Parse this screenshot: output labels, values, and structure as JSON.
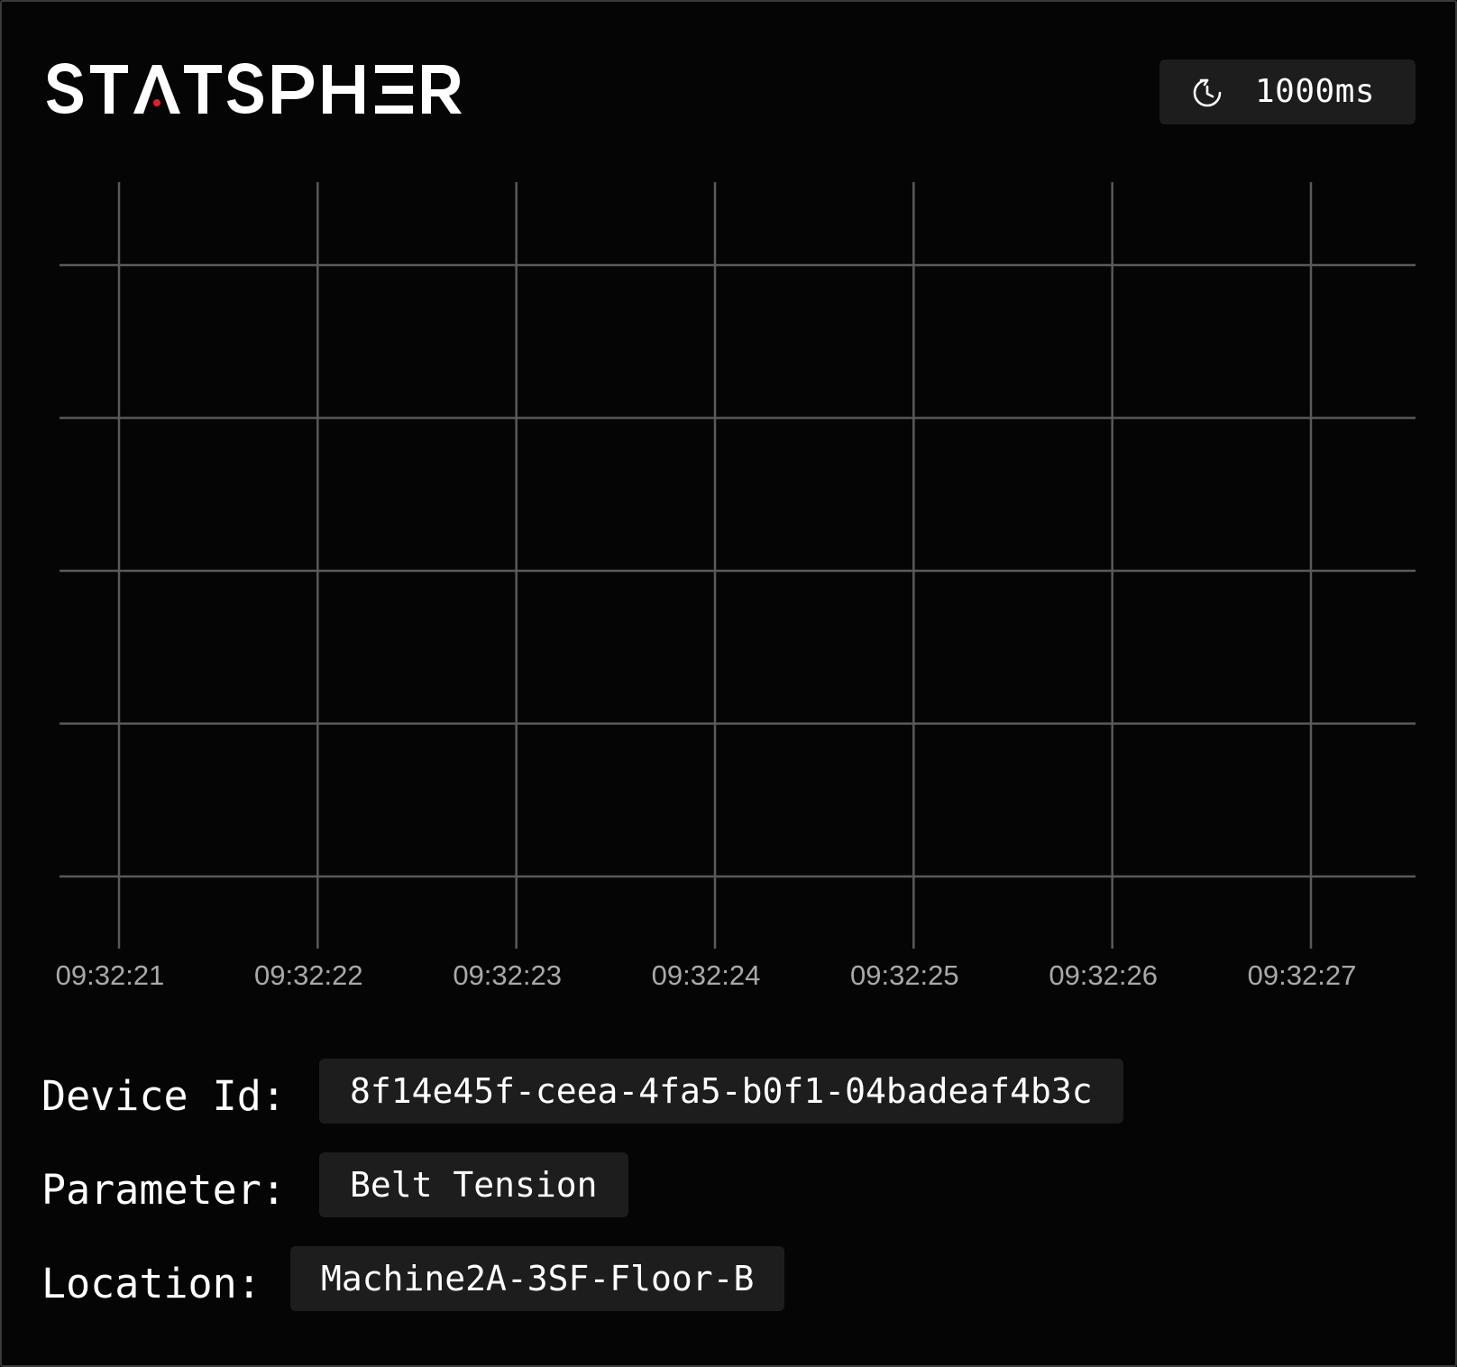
{
  "brand": {
    "name": "STATSPHERE",
    "accent_color": "#e0202a"
  },
  "header": {
    "refresh_icon": "refresh-clock-icon",
    "refresh_interval": "1000ms"
  },
  "chart_data": {
    "type": "line",
    "title": "",
    "xlabel": "",
    "ylabel": "",
    "categories": [
      "09:32:21",
      "09:32:22",
      "09:32:23",
      "09:32:24",
      "09:32:25",
      "09:32:26",
      "09:32:27"
    ],
    "series": [],
    "grid": true,
    "grid_color": "#5a5a5a",
    "horizontal_gridlines": 5
  },
  "info": {
    "device_id_label": "Device Id:",
    "device_id_value": "8f14e45f-ceea-4fa5-b0f1-04badeaf4b3c",
    "parameter_label": "Parameter:",
    "parameter_value": "Belt Tension",
    "location_label": "Location:",
    "location_value": "Machine2A-3SF-Floor-B"
  }
}
